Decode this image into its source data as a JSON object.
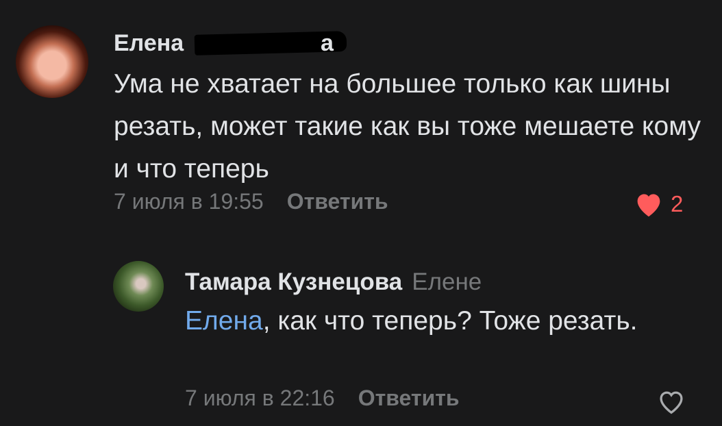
{
  "comment1": {
    "author": "Елена",
    "author_suffix": "а",
    "text": "Ума не хватает на большее только как шины резать, может такие как вы тоже мешаете кому и что теперь",
    "time": "7 июля в 19:55",
    "reply_label": "Ответить",
    "likes": "2",
    "liked": true
  },
  "comment2": {
    "author": "Тамара Кузнецова",
    "reply_to": "Елене",
    "mention": "Елена",
    "text": ", как что теперь? Тоже резать.",
    "time": "7 июля в 22:16",
    "reply_label": "Ответить",
    "liked": false
  },
  "colors": {
    "background": "#19191a",
    "text": "#e1e3e6",
    "secondary": "#76787a",
    "mention": "#71aaeb",
    "like": "#ff5c5c"
  },
  "icons": {
    "like_filled": "heart-filled-icon",
    "like_outline": "heart-outline-icon"
  }
}
